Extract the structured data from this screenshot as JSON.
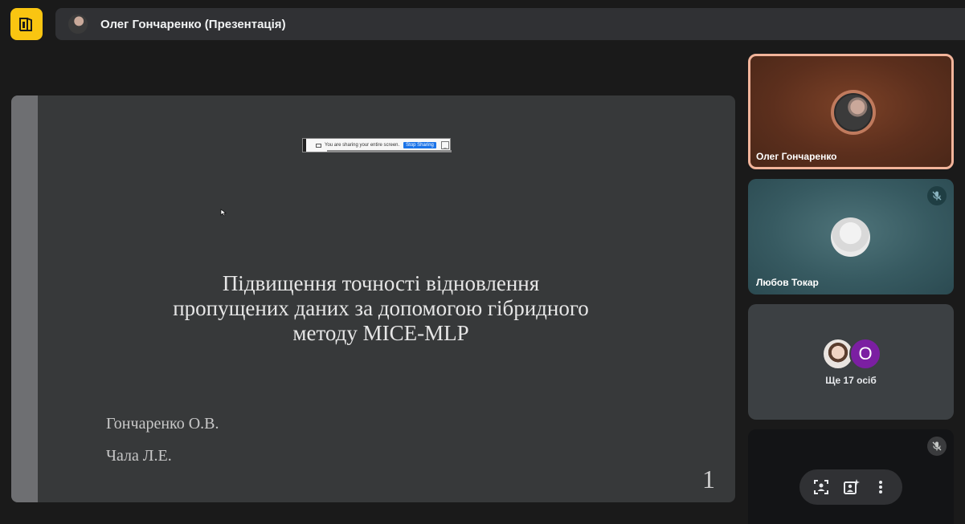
{
  "header": {
    "title": "Олег Гончаренко (Презентація)"
  },
  "presentation": {
    "share_bar": {
      "message": "You are sharing your entire screen.",
      "stop_label": "Stop Sharing",
      "hide_label": "_"
    },
    "slide": {
      "title_lines": [
        "Підвищення точності відновлення",
        "пропущених даних за допомогою гібридного",
        "методу MICE-MLP"
      ],
      "authors": [
        "Гончаренко О.В.",
        "Чала Л.Е."
      ],
      "page_number": "1"
    }
  },
  "participants": [
    {
      "name": "Олег Гончаренко",
      "speaking": true,
      "muted": false
    },
    {
      "name": "Любов Токар",
      "speaking": false,
      "muted": true
    }
  ],
  "group_tile": {
    "letter": "О",
    "label": "Ще 17 осіб"
  },
  "colors": {
    "logo": "#f9c511",
    "speaking_border": "#f2b49a",
    "group_letter_bg": "#7b1fa2"
  }
}
